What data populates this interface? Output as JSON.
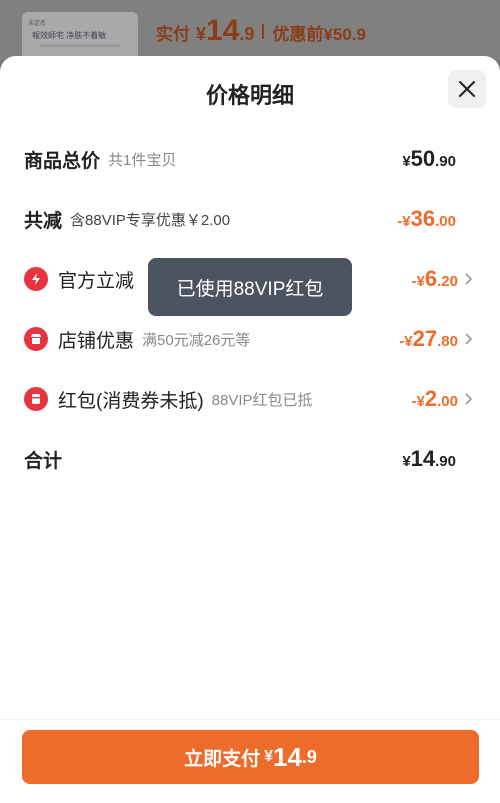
{
  "background": {
    "thumb_line1": "未定名",
    "thumb_line2": "報效師宅 净肤不着敏",
    "price_label": "实付",
    "price_yen": "¥",
    "price_int": "14",
    "price_dec": ".9",
    "before_text": "优惠前¥50.9"
  },
  "sheet": {
    "title": "价格明细",
    "close_icon": "close-icon"
  },
  "rows": {
    "total": {
      "label": "商品总价",
      "sub": "共1件宝贝",
      "yen": "¥",
      "int": "50",
      "dec": ".90"
    },
    "reduced": {
      "label": "共减",
      "sub": "含88VIP专享优惠￥2.00",
      "yen": "-¥",
      "int": "36",
      "dec": ".00"
    },
    "official": {
      "label": "官方立减",
      "yen": "-¥",
      "int": "6",
      "dec": ".20",
      "icon": "lightning-icon"
    },
    "store": {
      "label": "店铺优惠",
      "sub": "满50元减26元等",
      "yen": "-¥",
      "int": "27",
      "dec": ".80",
      "icon": "store-icon"
    },
    "redpacket": {
      "label": "红包(消费券未抵)",
      "sub": "88VIP红包已抵",
      "yen": "-¥",
      "int": "2",
      "dec": ".00",
      "icon": "red-packet-icon"
    },
    "sum": {
      "label": "合计",
      "yen": "¥",
      "int": "14",
      "dec": ".90"
    }
  },
  "tooltip": {
    "text": "已使用88VIP红包"
  },
  "pay_button": {
    "label": "立即支付",
    "yen": "¥",
    "int": "14",
    "dec": ".9"
  },
  "colors": {
    "accent": "#ee6c2b",
    "icon_red": "#e8343f",
    "tooltip_bg": "#4c5462"
  }
}
